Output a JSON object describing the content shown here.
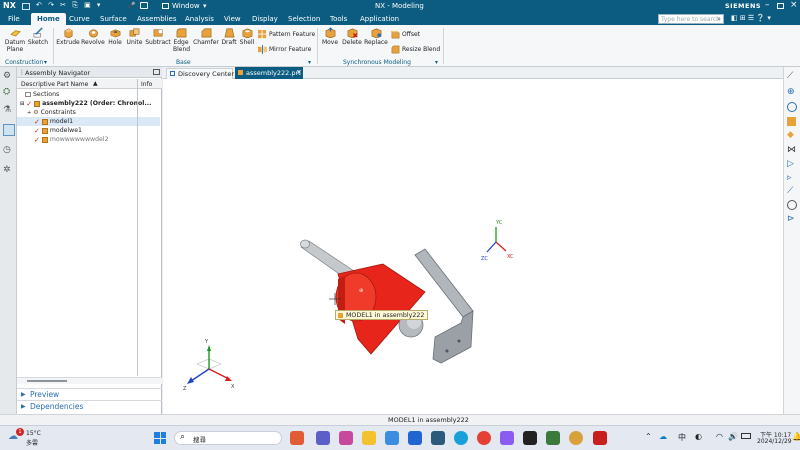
{
  "titlebar": {
    "logo": "NX",
    "window_menu": "Window",
    "title": "NX - Modeling",
    "brand": "SIEMENS"
  },
  "menubar": {
    "items": [
      "File",
      "Home",
      "Curve",
      "Surface",
      "Assemblies",
      "Analysis",
      "View",
      "Display",
      "Selection",
      "Tools",
      "Application"
    ],
    "active": "Home",
    "search_placeholder": "Type here to search"
  },
  "ribbon": {
    "construction": {
      "tools": [
        "Datum Plane",
        "Sketch"
      ],
      "label": "Construction"
    },
    "base": {
      "tools": [
        "Extrude",
        "Revolve",
        "Hole",
        "Unite",
        "Subtract",
        "Edge Blend",
        "Chamfer",
        "Draft",
        "Shell"
      ],
      "small_tools": [
        "Pattern Feature",
        "Mirror Feature"
      ],
      "label": "Base"
    },
    "sync": {
      "tools": [
        "Move",
        "Delete",
        "Replace"
      ],
      "small_tools": [
        "Offset",
        "Resize Blend"
      ],
      "label": "Synchronous Modeling"
    }
  },
  "navigator": {
    "title": "Assembly Navigator",
    "col_name": "Descriptive Part Name",
    "col_info": "Info",
    "rows": [
      {
        "label": "Sections",
        "indent": 0
      },
      {
        "label": "assembly222 (Order: Chronol...",
        "indent": 0
      },
      {
        "label": "Constraints",
        "indent": 1
      },
      {
        "label": "model1",
        "indent": 1
      },
      {
        "label": "modelwe1",
        "indent": 1
      },
      {
        "label": "mowwwwwwwdel2",
        "indent": 1
      }
    ],
    "preview": "Preview",
    "dependencies": "Dependencies"
  },
  "tabs": {
    "discovery": "Discovery Center",
    "file": "assembly222.prt"
  },
  "viewport": {
    "tooltip": "MODEL1 in assembly222",
    "axes": {
      "x": "XC",
      "y": "YC",
      "z": "ZC"
    },
    "triad": {
      "x": "X",
      "y": "Y",
      "z": "Z"
    }
  },
  "status": {
    "text": "MODEL1 in assembly222"
  },
  "taskbar": {
    "weather_temp": "15°C",
    "weather_desc": "多雲",
    "badge": "1",
    "search": "搜尋",
    "ime": "中",
    "time": "下午 10:17",
    "date": "2024/12/29"
  },
  "colors": {
    "titlebar": "#0b5c80",
    "part_red": "#e8251a",
    "bracket_gray": "#9aa0a6"
  }
}
